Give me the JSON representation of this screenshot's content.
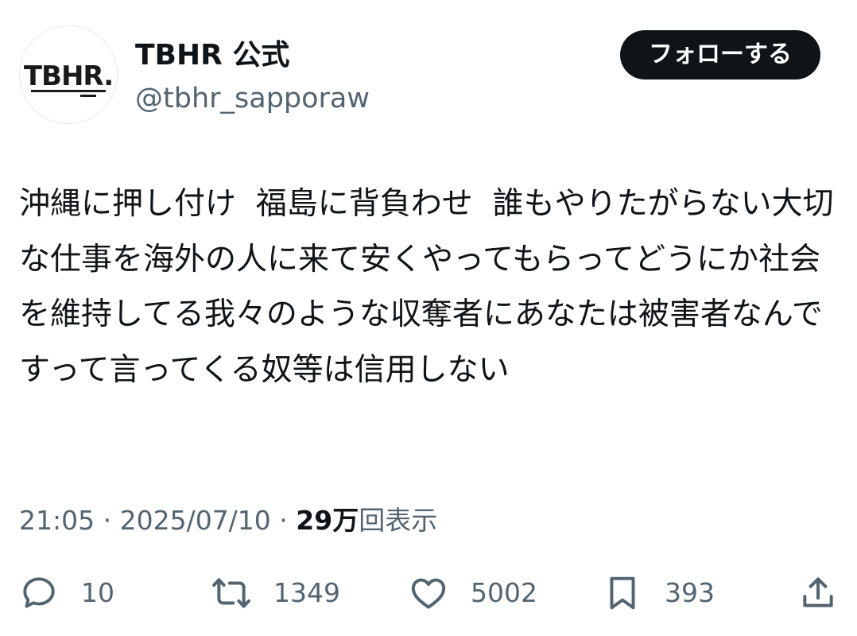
{
  "author": {
    "display_name": "TBHR 公式",
    "handle": "@tbhr_sapporaw",
    "avatar_logo_text": "TBHR."
  },
  "follow_button": {
    "label": "フォローする"
  },
  "tweet": {
    "text": "沖縄に押し付け  福島に背負わせ  誰もやりたがらない大切な仕事を海外の人に来て安くやってもらってどうにか社会を維持してる我々のような収奪者にあなたは被害者なんですって言ってくる奴等は信用しない"
  },
  "meta": {
    "time": "21:05",
    "separator": " · ",
    "date": "2025/07/10",
    "views_count": "29万",
    "views_label": "回表示"
  },
  "actions": {
    "replies": {
      "icon": "reply-icon",
      "count": "10"
    },
    "retweets": {
      "icon": "retweet-icon",
      "count": "1349"
    },
    "likes": {
      "icon": "heart-icon",
      "count": "5002"
    },
    "bookmarks": {
      "icon": "bookmark-icon",
      "count": "393"
    },
    "share": {
      "icon": "share-icon"
    }
  },
  "colors": {
    "text": "#0f1419",
    "secondary": "#536471",
    "button_bg": "#0f1419",
    "button_text": "#ffffff"
  }
}
